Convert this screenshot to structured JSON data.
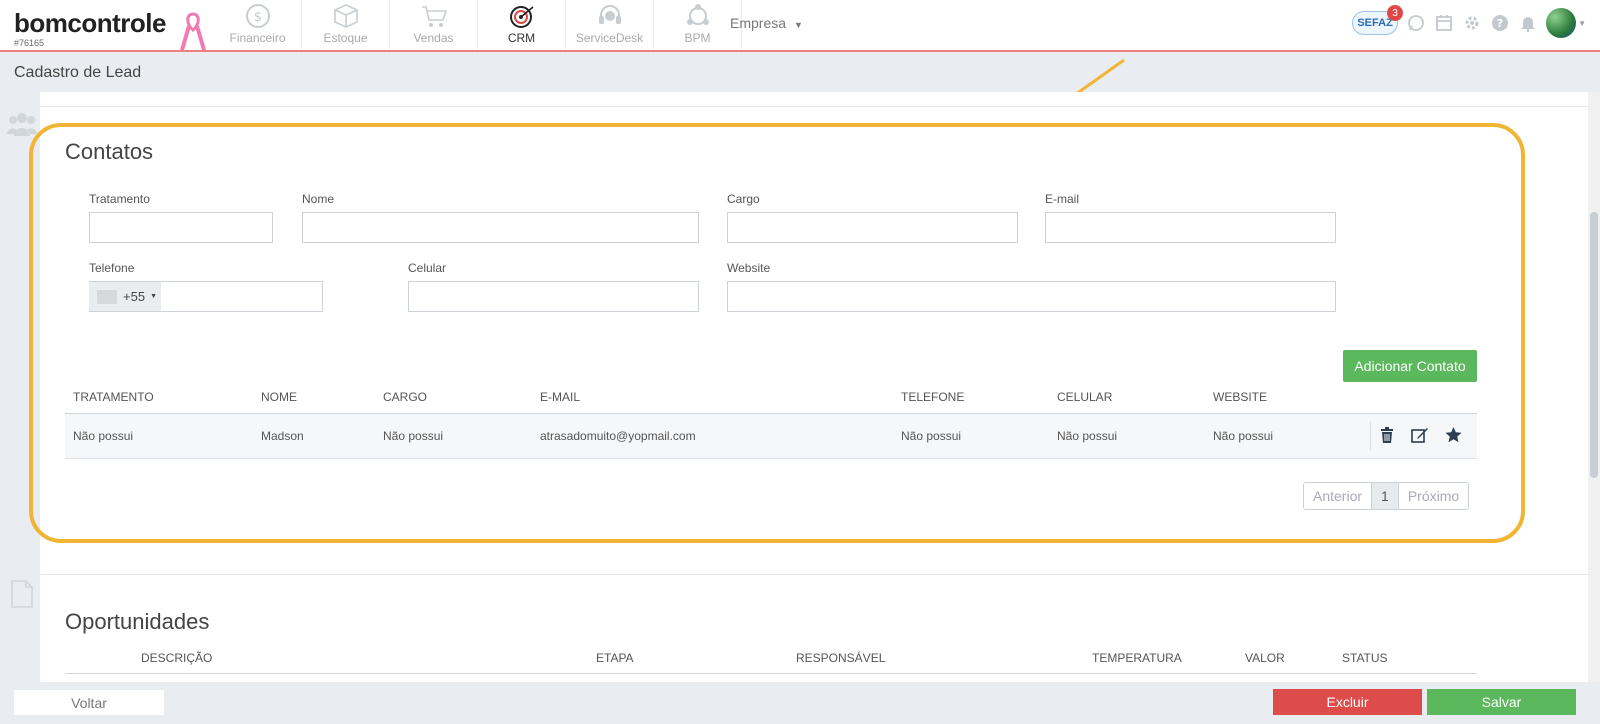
{
  "header": {
    "logo_text": "bomcontrole",
    "account_id": "#76165",
    "modules": [
      {
        "label": "Financeiro",
        "icon": "dollar-circle-icon",
        "active": false
      },
      {
        "label": "Estoque",
        "icon": "box-icon",
        "active": false
      },
      {
        "label": "Vendas",
        "icon": "cart-icon",
        "active": false
      },
      {
        "label": "CRM",
        "icon": "target-icon",
        "active": true
      },
      {
        "label": "ServiceDesk",
        "icon": "headset-icon",
        "active": false
      },
      {
        "label": "BPM",
        "icon": "process-icon",
        "active": false
      }
    ],
    "company_label": "Empresa",
    "sefaz_label": "SEFAZ",
    "sefaz_count": "3"
  },
  "page": {
    "title": "Cadastro de Lead"
  },
  "contacts": {
    "heading": "Contatos",
    "fields": {
      "tratamento": {
        "label": "Tratamento",
        "value": ""
      },
      "nome": {
        "label": "Nome",
        "value": ""
      },
      "cargo": {
        "label": "Cargo",
        "value": ""
      },
      "email": {
        "label": "E-mail",
        "value": ""
      },
      "telefone": {
        "label": "Telefone",
        "prefix": "+55",
        "value": ""
      },
      "celular": {
        "label": "Celular",
        "value": ""
      },
      "website": {
        "label": "Website",
        "value": ""
      }
    },
    "add_button": "Adicionar Contato",
    "table": {
      "columns": [
        "Tratamento",
        "Nome",
        "Cargo",
        "E-mail",
        "Telefone",
        "Celular",
        "Website"
      ],
      "rows": [
        [
          "Não possui",
          "Madson",
          "Não possui",
          "atrasadomuito@yopmail.com",
          "Não possui",
          "Não possui",
          "Não possui"
        ]
      ]
    },
    "pagination": {
      "prev": "Anterior",
      "current": "1",
      "next": "Próximo"
    }
  },
  "opportunities": {
    "heading": "Oportunidades",
    "columns": [
      "Descrição",
      "Etapa",
      "Responsável",
      "Temperatura",
      "Valor",
      "Status"
    ]
  },
  "footer": {
    "back": "Voltar",
    "delete": "Excluir",
    "save": "Salvar"
  },
  "colors": {
    "accent_red": "#f08080",
    "highlight": "#f1b533",
    "green": "#5cb85c",
    "red": "#dd4b4b"
  }
}
